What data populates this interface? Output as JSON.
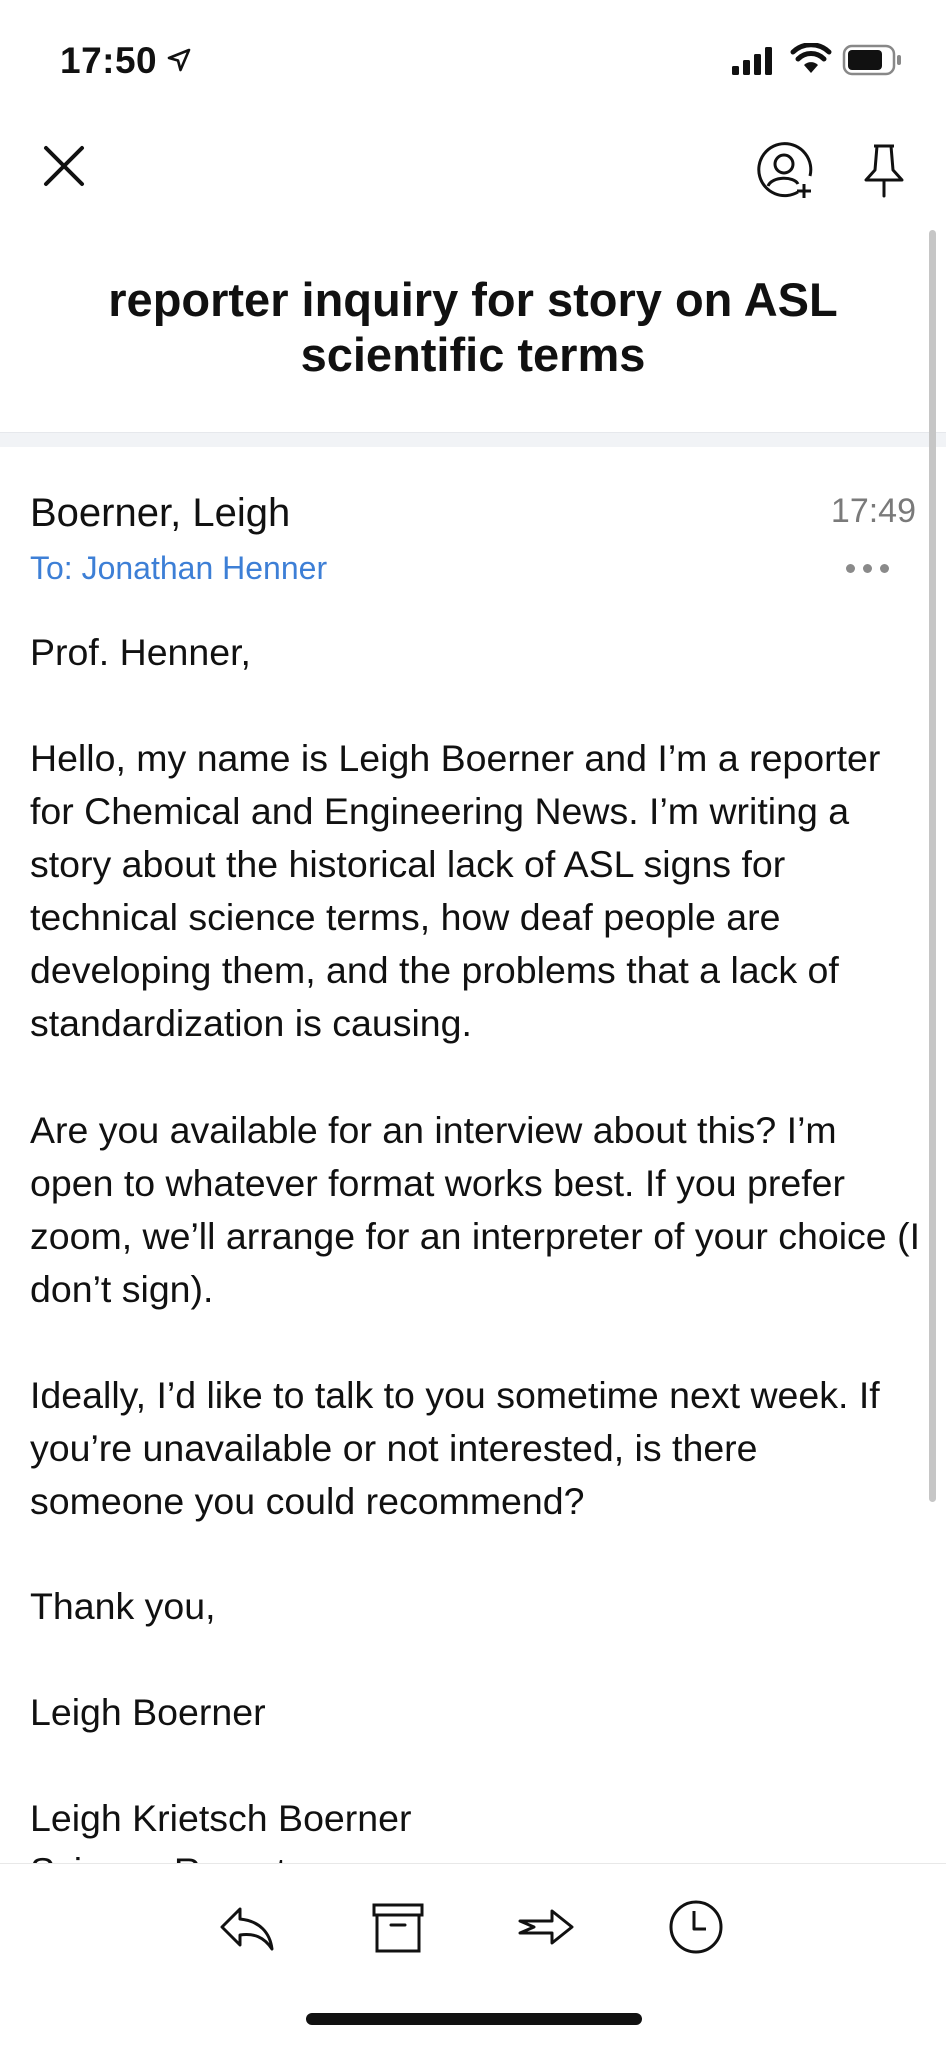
{
  "status_bar": {
    "time": "17:50",
    "icons": [
      "location-arrow-icon",
      "cellular-signal-icon",
      "wifi-icon",
      "battery-icon"
    ]
  },
  "top_bar": {
    "icons": [
      "close-icon",
      "add-contact-icon",
      "pin-icon"
    ]
  },
  "email": {
    "subject": "reporter inquiry for story on ASL scientific terms",
    "sender": "Boerner, Leigh",
    "time": "17:49",
    "recipient": "To: Jonathan Henner",
    "more_icon": "ellipsis-icon",
    "body": {
      "greeting": "Prof. Henner,",
      "intro": "Hello, my name is Leigh Boerner and I’m a reporter for Chemical and Engineering News. I’m writing a story about the historical lack of ASL signs for technical science terms, how deaf people are developing them, and the problems that a lack of standardization is causing.",
      "ask": "Are you available for an interview about this? I’m open to whatever format works best. If you prefer zoom, we’ll arrange for an interpreter of your choice (I don’t sign).",
      "timing": "Ideally, I’d like to talk to you sometime next week. If you’re unavailable or not interested, is there someone you could recommend?",
      "thanks": "Thank you,",
      "signoff_name": "Leigh Boerner",
      "signature_name": "Leigh Krietsch Boerner",
      "signature_title": "Science Reporter"
    }
  },
  "toolbar": {
    "icons": [
      "reply-icon",
      "archive-icon",
      "forward-icon",
      "snooze-clock-icon"
    ]
  },
  "colors": {
    "link_blue": "#3d7fd6",
    "text": "#111111",
    "muted": "#7a7a7a"
  }
}
